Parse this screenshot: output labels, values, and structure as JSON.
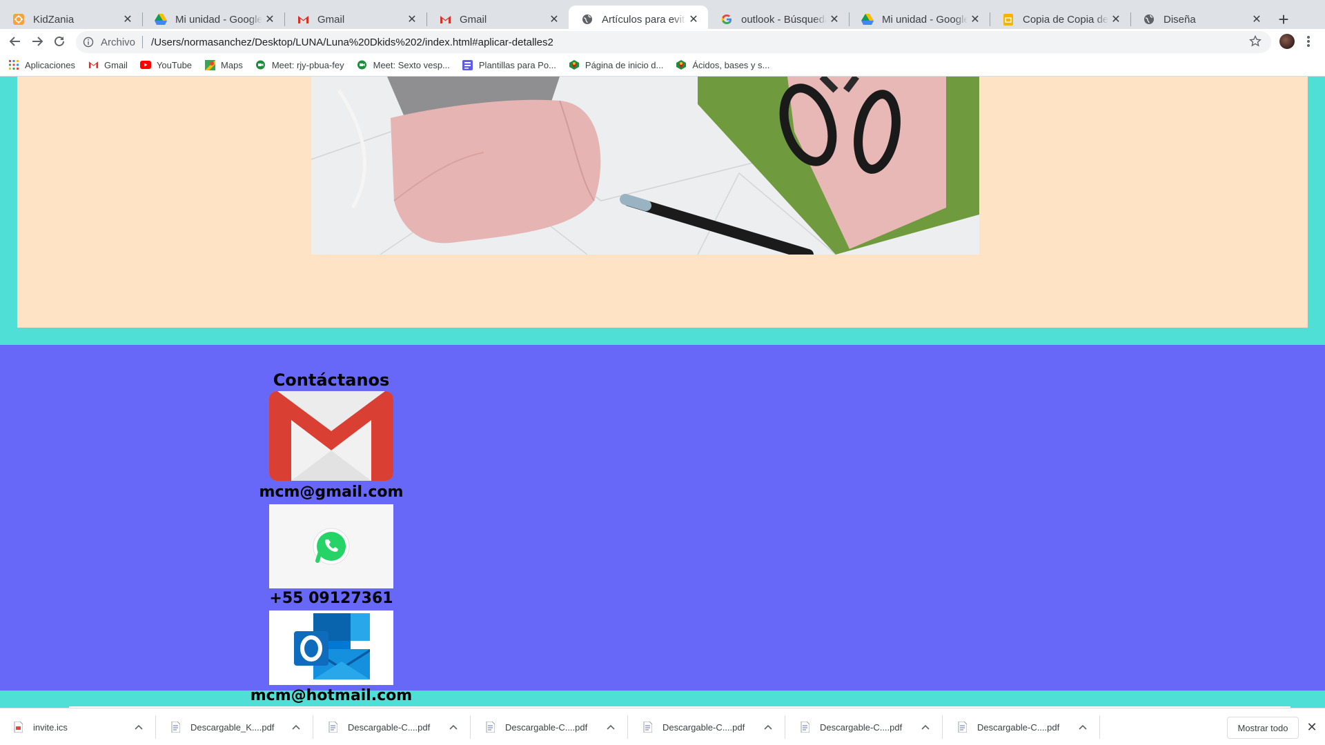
{
  "tabs": [
    {
      "title": "KidZania",
      "icon": "kidzania-icon",
      "active": false
    },
    {
      "title": "Mi unidad - Google Drive",
      "icon": "google-drive-icon",
      "active": false
    },
    {
      "title": "Gmail",
      "icon": "gmail-icon",
      "active": false
    },
    {
      "title": "Gmail",
      "icon": "gmail-icon",
      "active": false
    },
    {
      "title": "Artículos para evitar el contagio",
      "icon": "globe-icon",
      "active": true
    },
    {
      "title": "outlook - Búsqueda de Google",
      "icon": "google-icon",
      "active": false
    },
    {
      "title": "Mi unidad - Google Drive",
      "icon": "google-drive-icon",
      "active": false
    },
    {
      "title": "Copia de Copia de Super",
      "icon": "google-slides-icon",
      "active": false
    },
    {
      "title": "Diseña",
      "icon": "globe-icon",
      "active": false
    }
  ],
  "toolbar": {
    "scheme": "Archivo",
    "url": "/Users/normasanchez/Desktop/LUNA/Luna%20Dkids%202/index.html#aplicar-detalles2"
  },
  "bookmarks": [
    {
      "label": "Aplicaciones",
      "icon": "apps-grid-icon"
    },
    {
      "label": "Gmail",
      "icon": "gmail-icon"
    },
    {
      "label": "YouTube",
      "icon": "youtube-icon"
    },
    {
      "label": "Maps",
      "icon": "maps-icon"
    },
    {
      "label": "Meet: rjy-pbua-fey",
      "icon": "meet-icon"
    },
    {
      "label": "Meet: Sexto vesp...",
      "icon": "meet-icon"
    },
    {
      "label": "Plantillas para Po...",
      "icon": "plantillas-icon"
    },
    {
      "label": "Página de inicio d...",
      "icon": "bookmark-logo-icon"
    },
    {
      "label": "Ácidos, bases y s...",
      "icon": "bookmark-logo-icon"
    }
  ],
  "page": {
    "colors": {
      "outer": "#4fdfd6",
      "peach": "#ffe3c4",
      "contact_bg": "#6868f8"
    },
    "contact": {
      "title": "Contáctanos",
      "gmail": "mcm@gmail.com",
      "phone": "+55 09127361",
      "hotmail": "mcm@hotmail.com"
    }
  },
  "downloads": {
    "items": [
      {
        "name": "invite.ics"
      },
      {
        "name": "Descargable_K....pdf"
      },
      {
        "name": "Descargable-C....pdf"
      },
      {
        "name": "Descargable-C....pdf"
      },
      {
        "name": "Descargable-C....pdf"
      },
      {
        "name": "Descargable-C....pdf"
      },
      {
        "name": "Descargable-C....pdf"
      }
    ],
    "show_all": "Mostrar todo"
  }
}
